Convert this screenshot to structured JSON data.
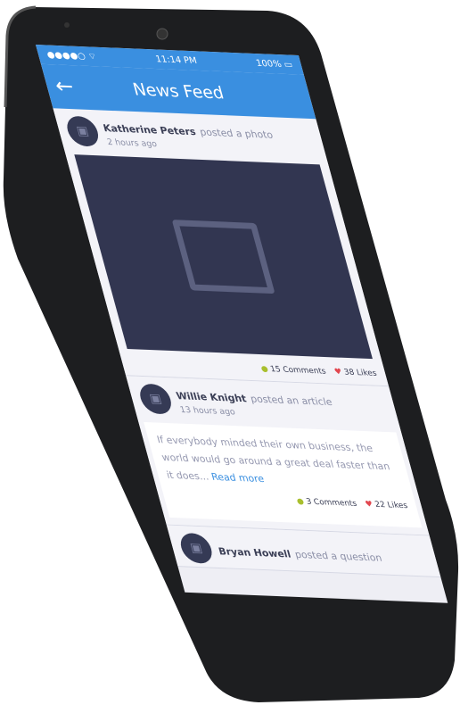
{
  "status": {
    "time": "11:14 PM",
    "battery": "100%"
  },
  "header": {
    "title": "News Feed",
    "back_icon": "arrow-left-icon"
  },
  "colors": {
    "accent": "#3a8fe0",
    "comment": "#a9bf2e",
    "like": "#e2474f"
  },
  "posts": [
    {
      "author": "Katherine Peters",
      "action": "posted a photo",
      "time": "2 hours ago",
      "comments": "15 Comments",
      "likes": "38 Likes"
    },
    {
      "author": "Willie Knight",
      "action": "posted an article",
      "time": "13 hours ago",
      "text": "If everybody minded their own business, the world would go around a great deal faster than it does...",
      "read_more": "Read more",
      "comments": "3 Comments",
      "likes": "22 Likes"
    },
    {
      "author": "Bryan Howell",
      "action": "posted a question"
    }
  ]
}
